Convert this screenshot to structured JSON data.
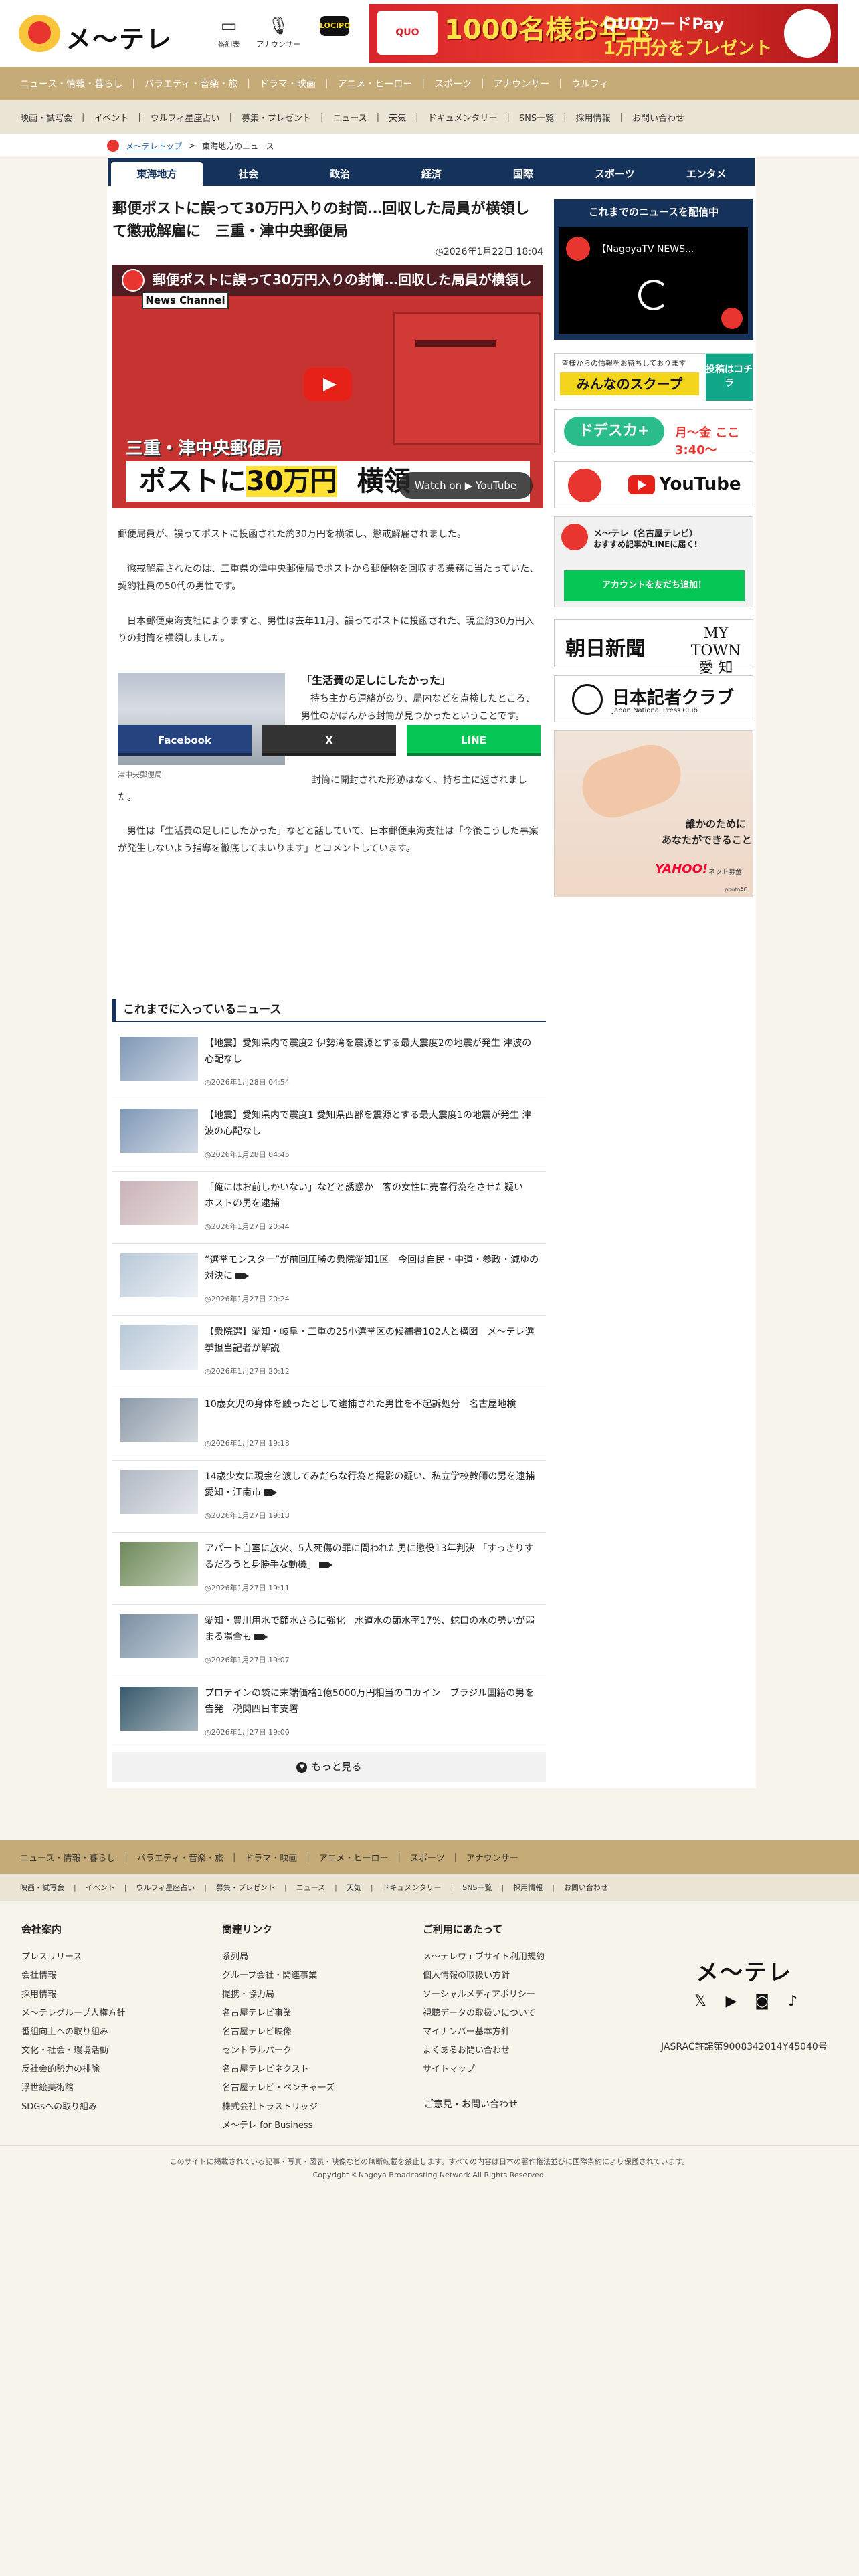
{
  "header": {
    "logo_text": "メ～テレ",
    "icons": [
      {
        "label": "番組表",
        "icon": "tv-icon"
      },
      {
        "label": "アナウンサー",
        "icon": "microphone-icon"
      },
      {
        "label": "LOCIPO",
        "icon": "locipo-icon"
      }
    ],
    "banner": {
      "left": "QUO",
      "big": "1000名様お年玉",
      "sub1": "QUOカードPay",
      "sub2": "1万円分をプレゼント"
    }
  },
  "nav_primary": [
    "ニュース・情報・暮らし",
    "バラエティ・音楽・旅",
    "ドラマ・映画",
    "アニメ・ヒーロー",
    "スポーツ",
    "アナウンサー",
    "ウルフィ"
  ],
  "nav_secondary": [
    "映画・試写会",
    "イベント",
    "ウルフィ星座占い",
    "募集・プレゼント",
    "ニュース",
    "天気",
    "ドキュメンタリー",
    "SNS一覧",
    "採用情報",
    "お問い合わせ"
  ],
  "breadcrumb": {
    "home": "メ～テレトップ",
    "separator": ">",
    "current": "東海地方のニュース"
  },
  "tabs": [
    "東海地方",
    "社会",
    "政治",
    "経済",
    "国際",
    "スポーツ",
    "エンタメ"
  ],
  "article": {
    "title": "郵便ポストに誤って30万円入りの封筒…回収した局員が横領して懲戒解雇に　三重・津中央郵便局",
    "date": "2026年1月22日 18:04",
    "video": {
      "top_title": "郵便ポストに誤って30万円入りの封筒…回収した局員が横領し",
      "channel": "News Channel",
      "caption_place": "三重・津中央郵便局",
      "caption_main_a": "ポストに",
      "caption_main_b": "30万円",
      "caption_main_c": "横領",
      "watch": "Watch on ▶ YouTube"
    },
    "p1": "郵便局員が、誤ってポストに投函された約30万円を横領し、懲戒解雇されました。",
    "p2": "　懲戒解雇されたのは、三重県の津中央郵便局でポストから郵便物を回収する業務に当たっていた、契約社員の50代の男性です。",
    "p3": "　日本郵便東海支社によりますと、男性は去年11月、誤ってポストに投函された、現金約30万円入りの封筒を横領しました。",
    "figure_caption": "津中央郵便局",
    "subhead": "「生活費の足しにしたかった」",
    "p4": "　持ち主から連絡があり、局内などを点検したところ、男性のかばんから封筒が見つかったということです。",
    "p5": "封筒に開封された形跡はなく、持ち主に返されました。",
    "p6": "　男性は「生活費の足しにしたかった」などと話していて、日本郵便東海支社は「今後こうした事案が発生しないよう指導を徹底してまいります」とコメントしています。"
  },
  "share": {
    "facebook": "Facebook",
    "x": "X",
    "line": "LINE"
  },
  "news_section": {
    "heading": "これまでに入っているニュース",
    "more": "もっと見る",
    "items": [
      {
        "title": "【地震】愛知県内で震度2 伊勢湾を震源とする最大震度2の地震が発生 津波の心配なし",
        "date": "2026年1月28日 04:54",
        "video": false
      },
      {
        "title": "【地震】愛知県内で震度1 愛知県西部を震源とする最大震度1の地震が発生 津波の心配なし",
        "date": "2026年1月28日 04:45",
        "video": false
      },
      {
        "title": "「俺にはお前しかいない」などと誘惑か　客の女性に売春行為をさせた疑い　ホストの男を逮捕",
        "date": "2026年1月27日 20:44",
        "video": false
      },
      {
        "title": "“選挙モンスター”が前回圧勝の衆院愛知1区　今回は自民・中道・参政・減ゆの対決に",
        "date": "2026年1月27日 20:24",
        "video": true
      },
      {
        "title": "【衆院選】愛知・岐阜・三重の25小選挙区の候補者102人と構図　メ～テレ選挙担当記者が解説",
        "date": "2026年1月27日 20:12",
        "video": false
      },
      {
        "title": "10歳女児の身体を触ったとして逮捕された男性を不起訴処分　名古屋地検",
        "date": "2026年1月27日 19:18",
        "video": false
      },
      {
        "title": "14歳少女に現金を渡してみだらな行為と撮影の疑い、私立学校教師の男を逮捕　愛知・江南市",
        "date": "2026年1月27日 19:18",
        "video": true
      },
      {
        "title": "アパート自室に放火、5人死傷の罪に問われた男に懲役13年判決 「すっきりするだろうと身勝手な動機」",
        "date": "2026年1月27日 19:11",
        "video": true
      },
      {
        "title": "愛知・豊川用水で節水さらに強化　水道水の節水率17%、蛇口の水の勢いが弱まる場合も",
        "date": "2026年1月27日 19:07",
        "video": true
      },
      {
        "title": "プロテインの袋に末端価格1億5000万円相当のコカイン　ブラジル国籍の男を告発　税関四日市支署",
        "date": "2026年1月27日 19:00",
        "video": false
      }
    ]
  },
  "sidebar": {
    "live_heading": "これまでのニュースを配信中",
    "live_title": "【NagoyaTV NEWS...",
    "scoop_small": "皆様からの情報をお待ちしております",
    "scoop_main": "みんなのスクープ",
    "scoop_side": "投稿はコチラ",
    "dore_main": "ドデスカ+",
    "dore_time": "月～金 ここ3:40～",
    "youtube": "YouTube",
    "line_t1": "メ～テレ（名古屋テレビ）",
    "line_t2": "おすすめ記事がLINEに届く!",
    "line_btn": "アカウントを友だち追加！",
    "asahi": "朝日新聞",
    "mytown": "MY TOWN 愛 知",
    "kisha": "日本記者クラブ",
    "kisha_en": "Japan National Press Club",
    "yahoo_t1": "誰かのために",
    "yahoo_t2": "あなたができること",
    "yahoo_logo": "YAHOO!",
    "yahoo_sub": "ネット募金",
    "photo": "photoAC"
  },
  "footer": {
    "nav_primary": [
      "ニュース・情報・暮らし",
      "バラエティ・音楽・旅",
      "ドラマ・映画",
      "アニメ・ヒーロー",
      "スポーツ",
      "アナウンサー"
    ],
    "nav_secondary": [
      "映画・試写会",
      "イベント",
      "ウルフィ星座占い",
      "募集・プレゼント",
      "ニュース",
      "天気",
      "ドキュメンタリー",
      "SNS一覧",
      "採用情報",
      "お問い合わせ"
    ],
    "col1": {
      "heading": "会社案内",
      "items": [
        "プレスリリース",
        "会社情報",
        "採用情報",
        "メ～テレグループ人権方針",
        "番組向上への取り組み",
        "文化・社会・環境活動",
        "反社会的勢力の排除",
        "浮世絵美術館",
        "SDGsへの取り組み"
      ]
    },
    "col2": {
      "heading": "関連リンク",
      "items": [
        "系列局",
        "グループ会社・関連事業",
        "提携・協力局",
        "名古屋テレビ事業",
        "名古屋テレビ映像",
        "セントラルパーク",
        "名古屋テレビネクスト",
        "名古屋テレビ・ベンチャーズ",
        "株式会社トラストリッジ",
        "メ～テレ for Business"
      ]
    },
    "col3": {
      "heading": "ご利用にあたって",
      "items": [
        "メ～テレウェブサイト利用規約",
        "個人情報の取扱い方針",
        "ソーシャルメディアポリシー",
        "視聴データの取扱いについて",
        "マイナンバー基本方針",
        "よくあるお問い合わせ",
        "サイトマップ"
      ]
    },
    "contact": "ご意見・お問い合わせ",
    "logo": "メ～テレ",
    "jasrac": "JASRAC許諾第9008342014Y45040号",
    "note": "このサイトに掲載されている記事・写真・図表・映像などの無断転載を禁止します。すべての内容は日本の著作権法並びに国際条約により保護されています。",
    "copyright": "Copyright ©Nagoya Broadcasting Network All Rights Reserved."
  }
}
